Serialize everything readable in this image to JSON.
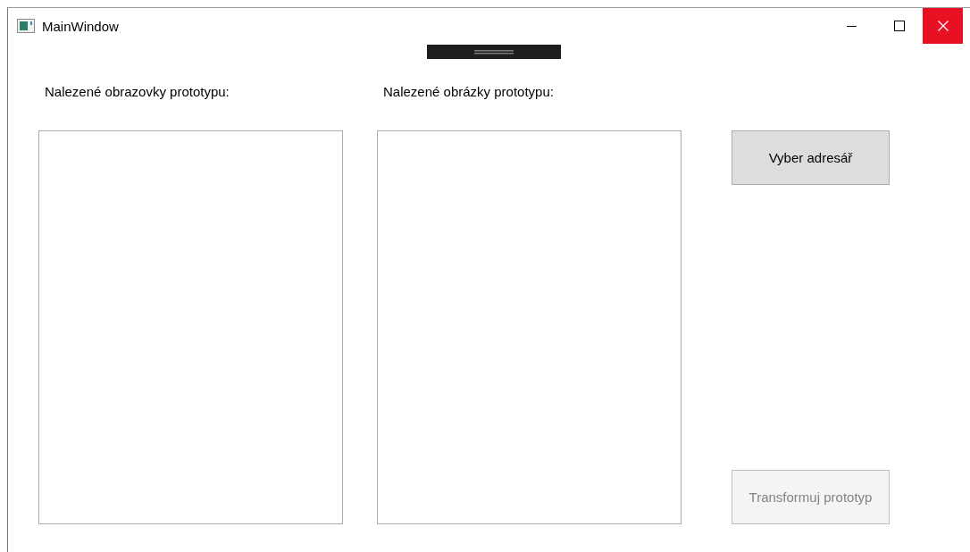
{
  "window": {
    "title": "MainWindow"
  },
  "lists": [
    {
      "label": "Nalezené obrazovky prototypu:"
    },
    {
      "label": "Nalezené obrázky prototypu:"
    }
  ],
  "buttons": [
    {
      "label": "Vyber adresář",
      "disabled": false
    },
    {
      "label": "Transformuj prototyp",
      "disabled": true
    }
  ]
}
